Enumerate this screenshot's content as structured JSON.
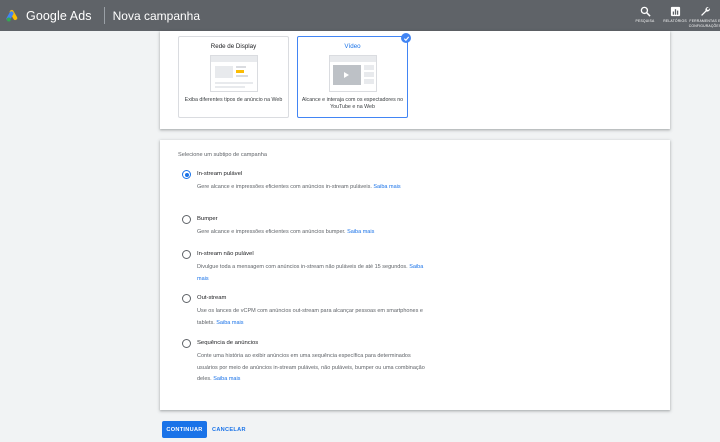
{
  "topbar": {
    "brand": "Google Ads",
    "campaign_title": "Nova campanha",
    "tools": [
      {
        "label": "PESQUISA",
        "icon": "search-icon"
      },
      {
        "label": "RELATÓRIOS",
        "icon": "reports-icon"
      },
      {
        "label": "FERRAMENTAS E CONFIGURAÇÕES",
        "icon": "wrench-icon"
      }
    ]
  },
  "campaign_types": [
    {
      "title": "Rede de Display",
      "description": "Exiba diferentes tipos de anúncio na Web",
      "selected": false
    },
    {
      "title": "Vídeo",
      "description": "Alcance e interaja com os espectadores no YouTube e na Web",
      "selected": true
    }
  ],
  "subtype_section": {
    "label": "Selecione um subtipo de campanha",
    "options": [
      {
        "name": "In-stream pulável",
        "description": "Gere alcance e impressões eficientes com anúncios in-stream puláveis.",
        "link": "Saiba mais",
        "selected": true
      },
      {
        "name": "Bumper",
        "description": "Gere alcance e impressões eficientes com anúncios bumper.",
        "link": "Saiba mais",
        "selected": false
      },
      {
        "name": "In-stream não pulável",
        "description": "Divulgue toda a mensagem com anúncios in-stream não puláveis de até 15 segundos.",
        "link": "Saiba mais",
        "selected": false
      },
      {
        "name": "Out-stream",
        "description": "Use os lances de vCPM com anúncios out-stream para alcançar pessoas em smartphones e tablets.",
        "link": "Saiba mais",
        "selected": false
      },
      {
        "name": "Sequência de anúncios",
        "description": "Conte uma história ao exibir anúncios em uma sequência específica para determinados usuários por meio de anúncios in-stream puláveis, não puláveis, bumper ou uma combinação deles.",
        "link": "Saiba mais",
        "selected": false
      }
    ]
  },
  "footer": {
    "continue_label": "CONTINUAR",
    "cancel_label": "CANCELAR"
  },
  "colors": {
    "topbar": "#5f6368",
    "accent": "#1a73e8",
    "selected_border": "#4285f4",
    "background": "#f1f3f4"
  }
}
